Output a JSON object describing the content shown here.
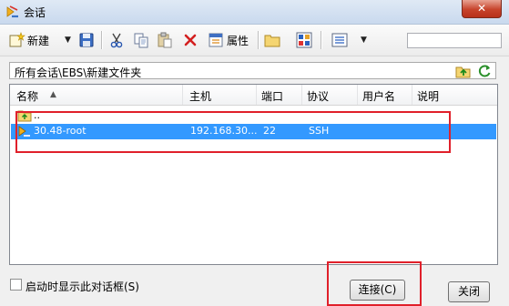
{
  "window": {
    "title": "会话",
    "close_symbol": "✕"
  },
  "toolbar": {
    "new_label": "新建",
    "properties_label": "属性",
    "dropdown_arrow": "▼",
    "search_value": "",
    "search_placeholder": ""
  },
  "path": {
    "value": "所有会话\\EBS\\新建文件夹"
  },
  "list": {
    "columns": [
      "名称",
      "主机",
      "端口",
      "协议",
      "用户名",
      "说明"
    ],
    "sort_indicator": "▲",
    "parent_row_label": "..",
    "rows": [
      {
        "name": "30.48-root",
        "host": "192.168.30...",
        "port": "22",
        "protocol": "SSH",
        "user": "",
        "desc": ""
      }
    ]
  },
  "footer": {
    "show_on_startup_label": "启动时显示此对话框(S)",
    "show_on_startup_checked": false,
    "connect_label": "连接(C)",
    "close_label": "关闭"
  },
  "colors": {
    "selection": "#3399ff",
    "highlight_box": "#e0202a"
  }
}
